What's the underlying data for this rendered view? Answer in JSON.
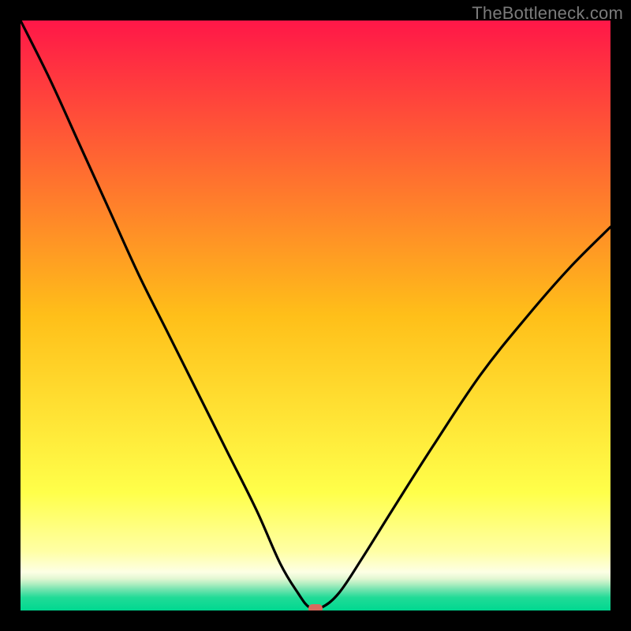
{
  "attribution": "TheBottleneck.com",
  "colors": {
    "frame": "#000000",
    "curve": "#000000",
    "marker": "#d96a5e",
    "gradient_stops": [
      {
        "offset": 0.0,
        "color": "#ff1748"
      },
      {
        "offset": 0.5,
        "color": "#ffbf19"
      },
      {
        "offset": 0.8,
        "color": "#ffff4a"
      },
      {
        "offset": 0.9,
        "color": "#ffffa5"
      },
      {
        "offset": 0.935,
        "color": "#fdffe5"
      },
      {
        "offset": 0.946,
        "color": "#e2f7d2"
      },
      {
        "offset": 0.955,
        "color": "#b0eec1"
      },
      {
        "offset": 0.965,
        "color": "#6fe3ae"
      },
      {
        "offset": 0.978,
        "color": "#21db97"
      },
      {
        "offset": 1.0,
        "color": "#00d890"
      }
    ]
  },
  "chart_data": {
    "type": "line",
    "title": "",
    "xlabel": "",
    "ylabel": "",
    "xlim": [
      0,
      100
    ],
    "ylim": [
      0,
      100
    ],
    "marker": {
      "x": 50,
      "y": 0
    },
    "series": [
      {
        "name": "curve",
        "x": [
          0,
          5,
          10,
          15,
          20,
          25,
          30,
          35,
          40,
          44,
          47,
          49,
          51,
          54,
          58,
          63,
          70,
          78,
          86,
          93,
          100
        ],
        "values": [
          100,
          90,
          79,
          68,
          57,
          47,
          37,
          27,
          17,
          8,
          3,
          0.5,
          0.5,
          3,
          9,
          17,
          28,
          40,
          50,
          58,
          65
        ]
      }
    ]
  }
}
